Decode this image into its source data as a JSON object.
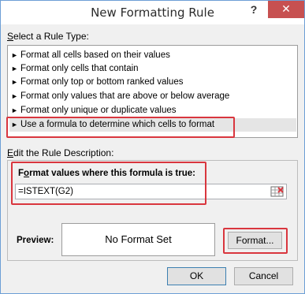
{
  "window": {
    "title": "New Formatting Rule",
    "help_label": "?",
    "close_label": "✕"
  },
  "rule_type": {
    "label_prefix": "S",
    "label_rest": "elect a Rule Type:",
    "items": [
      {
        "label": "Format all cells based on their values"
      },
      {
        "label": "Format only cells that contain"
      },
      {
        "label": "Format only top or bottom ranked values"
      },
      {
        "label": "Format only values that are above or below average"
      },
      {
        "label": "Format only unique or duplicate values"
      },
      {
        "label": "Use a formula to determine which cells to format"
      }
    ],
    "selected_index": 5
  },
  "description": {
    "label_prefix": "E",
    "label_rest": "dit the Rule Description:",
    "formula_label_prefix": "F",
    "formula_label_middle": "o",
    "formula_label_rest": "rmat values where this formula is true:",
    "formula_value": "=ISTEXT(G2)"
  },
  "preview": {
    "label": "Preview:",
    "text": "No Format Set"
  },
  "buttons": {
    "format_label": "Format...",
    "ok_label": "OK",
    "cancel_label": "Cancel"
  },
  "colors": {
    "highlight": "#d9363e",
    "close_button": "#c75050",
    "selected_row": "#e5e5e5"
  }
}
